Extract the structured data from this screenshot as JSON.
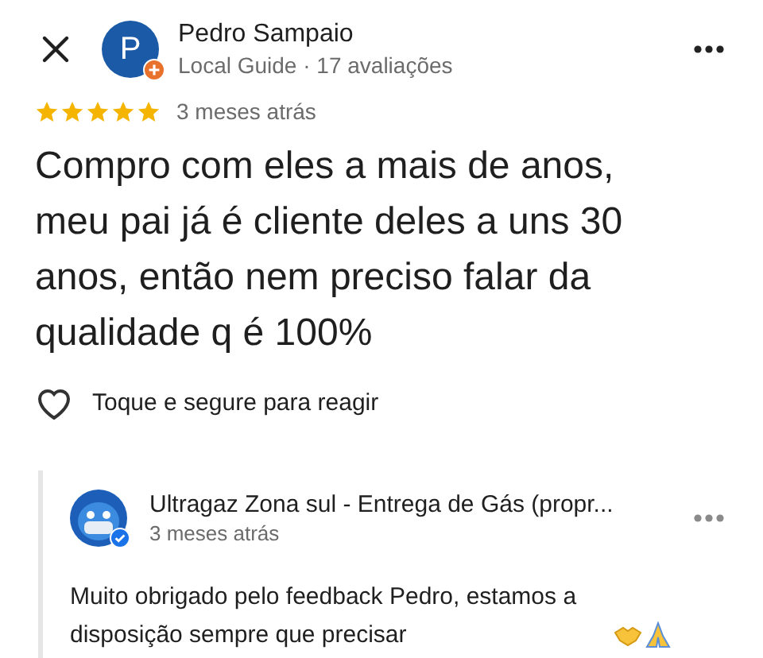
{
  "review": {
    "author": {
      "initial": "P",
      "name": "Pedro Sampaio",
      "subtitle": "Local Guide · 17 avaliações",
      "local_guide": true
    },
    "stars": 5,
    "time": "3 meses atrás",
    "text": "Compro com eles a mais de anos, meu pai já é cliente deles a uns 30 anos, então nem preciso falar da qualidade q é 100%",
    "reaction": {
      "label": "Toque e segure para reagir",
      "liked": false
    }
  },
  "reply": {
    "name": "Ultragaz Zona sul - Entrega de Gás (propr...",
    "verified": true,
    "time": "3 meses atrás",
    "text": "Muito obrigado pelo feedback Pedro, estamos a disposição sempre que precisar"
  }
}
